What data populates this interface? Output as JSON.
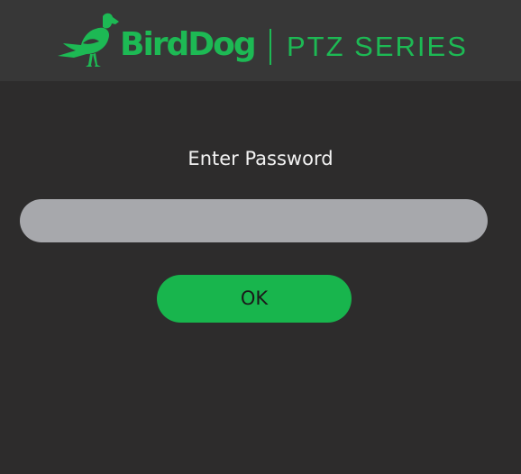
{
  "header": {
    "brand_name": "BirdDog",
    "series_label": "PTZ SERIES",
    "logo_icon": "bird-dog-logo-icon",
    "accent_color": "#1db954",
    "background_color": "#373737"
  },
  "login": {
    "prompt": "Enter Password",
    "password_value": "",
    "password_placeholder": "",
    "ok_label": "OK",
    "button_color": "#18b54d",
    "input_color": "#a7a8ac"
  }
}
